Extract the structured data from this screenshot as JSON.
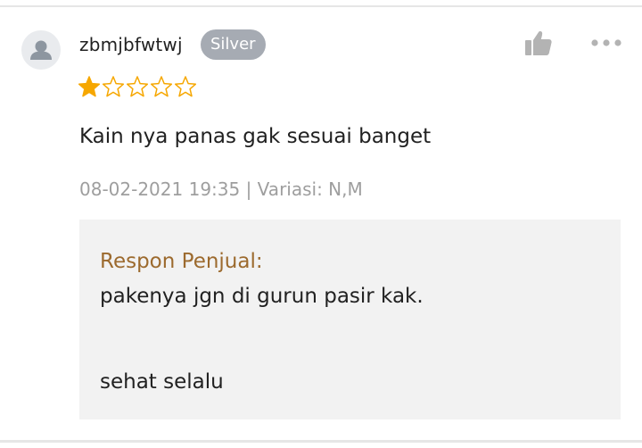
{
  "review": {
    "username": "zbmjbfwtwj",
    "badge": "Silver",
    "rating": 1,
    "rating_max": 5,
    "comment": "Kain nya panas gak sesuai banget",
    "meta": "08-02-2021 19:35 | Variasi: N,M",
    "seller_response": {
      "title": "Respon Penjual:",
      "text": "pakenya jgn di gurun pasir kak.\n\n\nsehat selalu"
    }
  },
  "icons": {
    "avatar": "default-user-avatar-icon",
    "like": "thumbs-up-icon",
    "more": "more-horizontal-icon",
    "star_filled": "star-filled-icon",
    "star_empty": "star-outline-icon"
  },
  "colors": {
    "star": "#f6a700",
    "badge_bg": "#a6abb3",
    "seller_title": "#9c6a2e",
    "meta_text": "#9e9e9e",
    "seller_box_bg": "#f2f2f2",
    "icon_gray": "#b3b3b3"
  }
}
